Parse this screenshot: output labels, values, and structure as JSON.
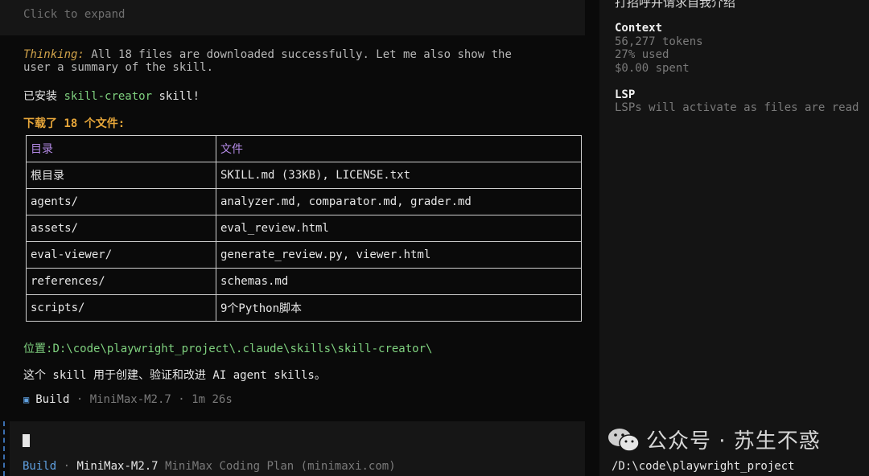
{
  "expand": {
    "label": "Click to expand"
  },
  "thinking": {
    "label": "Thinking:",
    "line1": "All 18 files are downloaded successfully. Let me also show the",
    "line2": "user a summary of the skill."
  },
  "installed": {
    "prefix": "已安装 ",
    "skill_name": "skill-creator",
    "suffix": " skill!"
  },
  "downloaded": {
    "text": "下载了 18 个文件:"
  },
  "table": {
    "headers": [
      "目录",
      "文件"
    ],
    "rows": [
      [
        "根目录",
        "SKILL.md (33KB), LICENSE.txt"
      ],
      [
        "agents/",
        "analyzer.md, comparator.md, grader.md"
      ],
      [
        "assets/",
        "eval_review.html"
      ],
      [
        "eval-viewer/",
        "generate_review.py, viewer.html"
      ],
      [
        "references/",
        "schemas.md"
      ],
      [
        "scripts/",
        "9个Python脚本"
      ]
    ]
  },
  "location": {
    "label": "位置:",
    "path": "D:\\code\\playwright_project\\.claude\\skills\\skill-creator\\"
  },
  "description": {
    "text": "这个 skill 用于创建、验证和改进 AI agent skills。"
  },
  "build_status": {
    "icon": "build-square-icon",
    "mode": "Build",
    "separator": "·",
    "model": "MiniMax-M2.7",
    "duration": "1m 26s"
  },
  "footer": {
    "mode": "Build",
    "separator": "·",
    "model": "MiniMax-M2.7",
    "plan": "MiniMax Coding Plan (minimaxi.com)"
  },
  "sidebar": {
    "cut_title": "打招呼并请求自我介绍",
    "context": {
      "heading": "Context",
      "tokens": "56,277 tokens",
      "used": "27% used",
      "spent": "$0.00 spent"
    },
    "lsp": {
      "heading": "LSP",
      "text": "LSPs will activate as files are read"
    },
    "path": "/D:\\code\\playwright_project"
  },
  "watermark": {
    "text": "公众号 · 苏生不惑",
    "icon": "wechat-icon"
  },
  "colors": {
    "accent_green": "#7fd17f",
    "accent_orange": "#e8a73a",
    "accent_purple": "#b48ae6",
    "accent_blue": "#5fa0e0"
  }
}
